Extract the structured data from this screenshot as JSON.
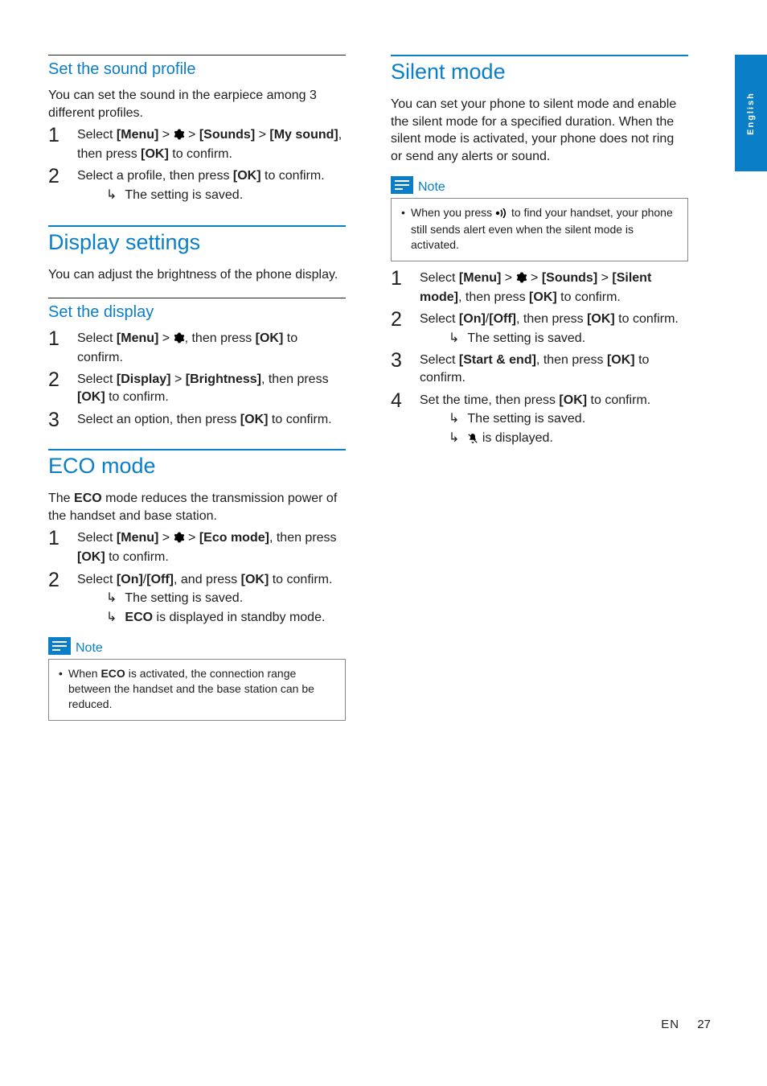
{
  "lang_tab": "English",
  "sections": {
    "sound_profile": {
      "title": "Set the sound profile",
      "intro": "You can set the sound in the earpiece among 3 different profiles.",
      "step1_a": "Select ",
      "step1_b": "[Menu]",
      "step1_c": " > ",
      "step1_d": " > ",
      "step1_e": "[Sounds]",
      "step1_f": " > ",
      "step1_g": "[My sound]",
      "step1_h": ", then press ",
      "step1_i": "[OK]",
      "step1_j": " to confirm.",
      "step2_a": "Select a profile, then press ",
      "step2_b": "[OK]",
      "step2_c": " to confirm.",
      "result": "The setting is saved."
    },
    "display_settings": {
      "title": "Display settings",
      "intro": "You can adjust the brightness of the phone display."
    },
    "set_display": {
      "title": "Set the display",
      "step1_a": "Select ",
      "step1_b": "[Menu]",
      "step1_c": " > ",
      "step1_d": ", then press ",
      "step1_e": "[OK]",
      "step1_f": " to confirm.",
      "step2_a": "Select ",
      "step2_b": "[Display]",
      "step2_c": " > ",
      "step2_d": "[Brightness]",
      "step2_e": ", then press ",
      "step2_f": "[OK]",
      "step2_g": " to confirm.",
      "step3_a": "Select an option, then press ",
      "step3_b": "[OK]",
      "step3_c": " to confirm."
    },
    "eco_mode": {
      "title": "ECO mode",
      "intro_a": "The ",
      "intro_b": "ECO",
      "intro_c": " mode reduces the transmission power of the handset and base station.",
      "step1_a": "Select ",
      "step1_b": "[Menu]",
      "step1_c": " > ",
      "step1_d": " > ",
      "step1_e": "[Eco mode]",
      "step1_f": ", then press ",
      "step1_g": "[OK]",
      "step1_h": " to confirm.",
      "step2_a": "Select ",
      "step2_b": "[On]",
      "step2_c": "/",
      "step2_d": "[Off]",
      "step2_e": ", and press ",
      "step2_f": "[OK]",
      "step2_g": " to confirm.",
      "result1": "The setting is saved.",
      "result2_a": "ECO",
      "result2_b": " is displayed in standby mode.",
      "note_label": "Note",
      "note_a": "When ",
      "note_b": "ECO",
      "note_c": " is activated, the connection range between the handset and the base station can be reduced."
    },
    "silent_mode": {
      "title": "Silent mode",
      "intro": "You can set your phone to silent mode and enable the silent mode for a specified duration. When the silent mode is activated, your phone does not ring or send any alerts or sound.",
      "note_label": "Note",
      "note_a": "When you press ",
      "note_b": " to find your handset, your phone still sends alert even when the silent mode is activated.",
      "step1_a": "Select ",
      "step1_b": "[Menu]",
      "step1_c": " > ",
      "step1_d": " > ",
      "step1_e": "[Sounds]",
      "step1_f": " > ",
      "step1_g": "[Silent mode]",
      "step1_h": ", then press ",
      "step1_i": "[OK]",
      "step1_j": " to confirm.",
      "step2_a": "Select ",
      "step2_b": "[On]",
      "step2_c": "/",
      "step2_d": "[Off]",
      "step2_e": ", then press ",
      "step2_f": "[OK]",
      "step2_g": " to confirm.",
      "result2": "The setting is saved.",
      "step3_a": "Select ",
      "step3_b": "[Start & end]",
      "step3_c": ", then press ",
      "step3_d": "[OK]",
      "step3_e": " to confirm.",
      "step4_a": "Set the time, then press ",
      "step4_b": "[OK]",
      "step4_c": " to confirm.",
      "result4a": "The setting is saved.",
      "result4b": " is displayed."
    }
  },
  "footer": {
    "lang": "EN",
    "page": "27"
  }
}
